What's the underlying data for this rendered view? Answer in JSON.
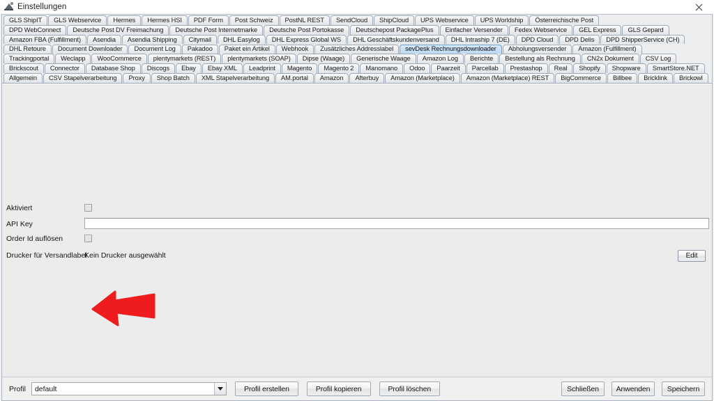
{
  "window": {
    "title": "Einstellungen",
    "icon": "app-icon",
    "close_icon": "close-icon"
  },
  "tabs": {
    "selected": "sevDesk Rechnungsdownloader",
    "rows": [
      [
        "GLS ShipIT",
        "GLS Webservice",
        "Hermes",
        "Hermes HSI",
        "PDF Form",
        "Post Schweiz",
        "PostNL REST",
        "SendCloud",
        "ShipCloud",
        "UPS Webservice",
        "UPS Worldship",
        "Österreichische Post"
      ],
      [
        "DPD WebConnect",
        "Deutsche Post DV Freimachung",
        "Deutsche Post Internetmarke",
        "Deutsche Post Portokasse",
        "Deutschepost PackagePlus",
        "Einfacher Versender",
        "Fedex Webservice",
        "GEL Express",
        "GLS Gepard"
      ],
      [
        "Amazon FBA (Fulfillment)",
        "Asendia",
        "Asendia Shipping",
        "Citymail",
        "DHL Easylog",
        "DHL Express Global WS",
        "DHL Geschäftskundenversand",
        "DHL Intraship 7 (DE)",
        "DPD Cloud",
        "DPD Delis",
        "DPD ShipperService (CH)"
      ],
      [
        "DHL Retoure",
        "Document Downloader",
        "Document Log",
        "Pakadoo",
        "Paket ein Artikel",
        "Webhook",
        "Zusätzliches Addresslabel",
        "sevDesk Rechnungsdownloader",
        "Abholungsversender",
        "Amazon (Fulfillment)"
      ],
      [
        "Trackingportal",
        "Weclapp",
        "WooCommerce",
        "plentymarkets (REST)",
        "plentymarkets (SOAP)",
        "Dipse (Waage)",
        "Generische Waage",
        "Amazon Log",
        "Berichte",
        "Bestellung als Rechnung",
        "CN2x Dokument",
        "CSV Log"
      ],
      [
        "Brickscout",
        "Connector",
        "Database Shop",
        "Discogs",
        "Ebay",
        "Ebay XML",
        "Leadprint",
        "Magento",
        "Magento 2",
        "Manomano",
        "Odoo",
        "Paarzeit",
        "Parcellab",
        "Prestashop",
        "Real",
        "Shopify",
        "Shopware",
        "SmartStore.NET"
      ],
      [
        "Allgemein",
        "CSV Stapelverarbeitung",
        "Proxy",
        "Shop Batch",
        "XML Stapelverarbeitung",
        "AM.portal",
        "Amazon",
        "Afterbuy",
        "Amazon (Marketplace)",
        "Amazon (Marketplace) REST",
        "BigCommerce",
        "Billbee",
        "Bricklink",
        "Brickowl"
      ]
    ]
  },
  "form": {
    "aktiviert_label": "Aktiviert",
    "aktiviert_checked": false,
    "api_key_label": "API Key",
    "api_key_value": "",
    "order_id_label": "Order Id auflösen",
    "order_id_checked": false,
    "drucker_label": "Drucker für Versandlabel",
    "drucker_value": "Kein Drucker ausgewählt",
    "edit_button": "Edit"
  },
  "annotation": {
    "arrow_color": "#ee1c1c",
    "arrow_icon": "red-arrow-pointer"
  },
  "bottom": {
    "profil_label": "Profil",
    "profil_value": "default",
    "profil_erstellen": "Profil erstellen",
    "profil_kopieren": "Profil kopieren",
    "profil_loeschen": "Profil löschen",
    "schliessen": "Schließen",
    "anwenden": "Anwenden",
    "speichern": "Speichern"
  }
}
